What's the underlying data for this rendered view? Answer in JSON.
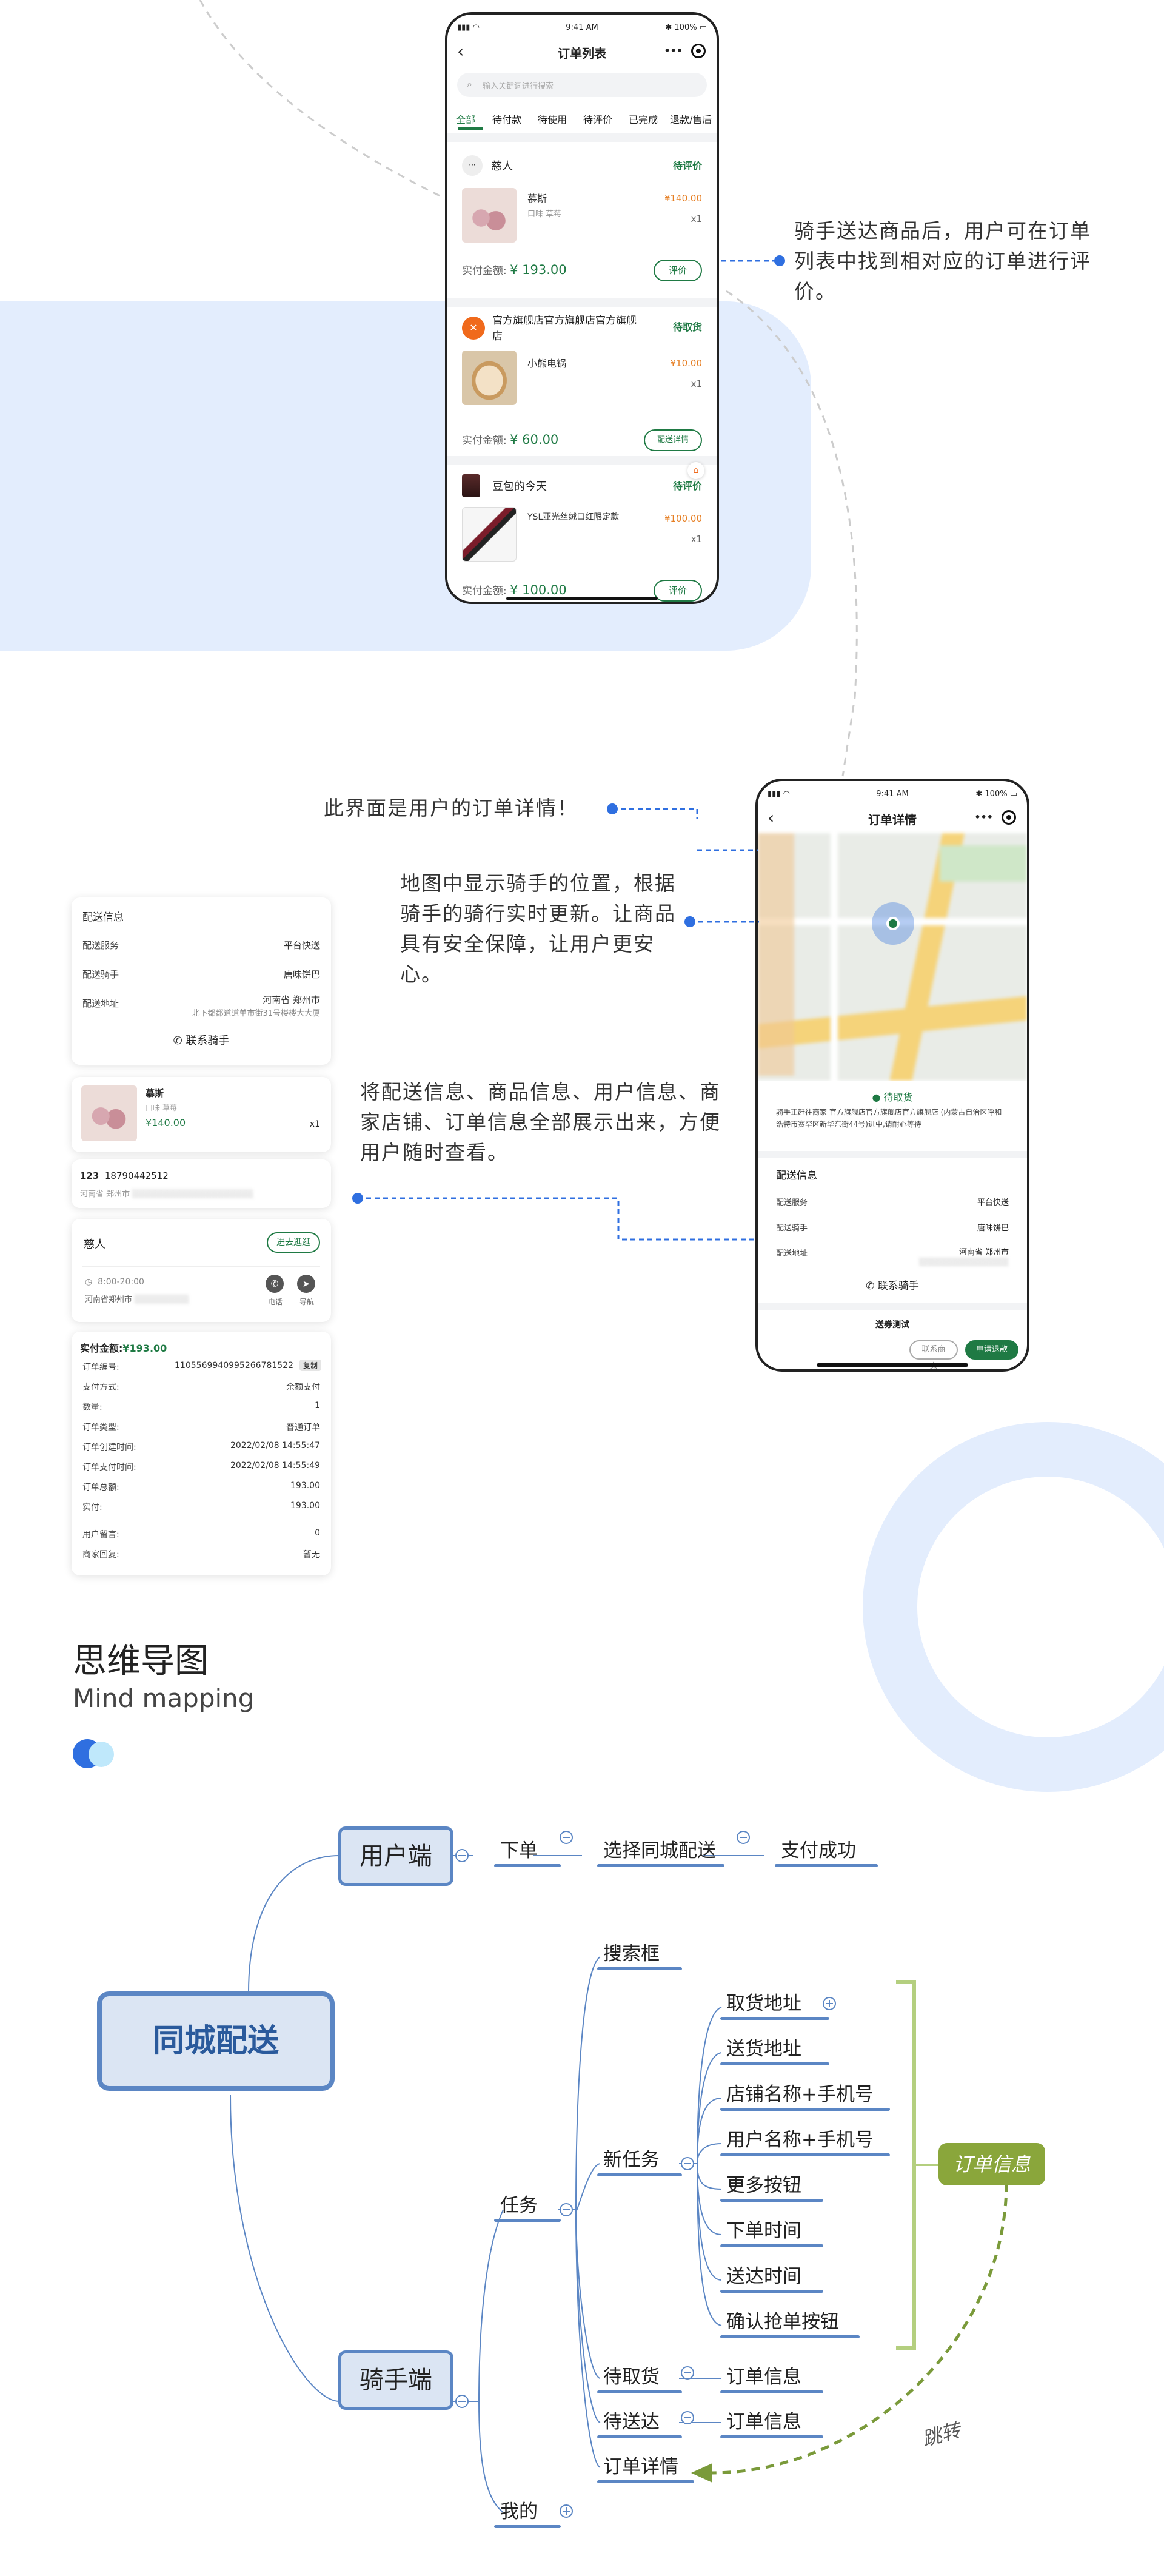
{
  "colors": {
    "green": "#1f7a44",
    "blue": "#2f6fe0",
    "lightblue": "#e3edfd",
    "orange": "#e67e22",
    "olive": "#8aa63b",
    "node_blue": "#5b86c4"
  },
  "phone1": {
    "status_time": "9:41 AM",
    "battery": "100%",
    "title": "订单列表",
    "more": "•••",
    "search_placeholder": "输入关键词进行搜索",
    "tabs": [
      "全部",
      "待付款",
      "待使用",
      "待评价",
      "已完成",
      "退款/售后"
    ],
    "orders": [
      {
        "store": "慈人",
        "status": "待评价",
        "product": "慕斯",
        "spec": "口味 草莓",
        "price": "¥140.00",
        "qty": "x1",
        "pay_label": "实付金额:",
        "pay_amount": "¥ 193.00",
        "button": "评价"
      },
      {
        "store": "官方旗舰店官方旗舰店官方旗舰店",
        "status": "待取货",
        "product": "小熊电锅",
        "price": "¥10.00",
        "qty": "x1",
        "pay_label": "实付金额:",
        "pay_amount": "¥ 60.00",
        "button": "配送详情"
      },
      {
        "store": "豆包的今天",
        "status": "待评价",
        "product": "YSL亚光丝绒口红限定款",
        "price": "¥100.00",
        "qty": "x1",
        "pay_label": "实付金额:",
        "pay_amount": "¥ 100.00",
        "button": "评价"
      }
    ]
  },
  "anno1": "骑手送达商品后，用户可在订单列表中找到相对应的订单进行评价。",
  "anno2": "此界面是用户的订单详情！",
  "anno3": "地图中显示骑手的位置，根据骑手的骑行实时更新。让商品具有安全保障，让用户更安心。",
  "anno4": "将配送信息、商品信息、用户信息、商家店铺、订单信息全部展示出来，方便用户随时查看。",
  "phone2": {
    "status_time": "9:41 AM",
    "battery": "100%",
    "title": "订单详情",
    "more": "•••",
    "status": "待取货",
    "desc": "骑手正赶往商家 官方旗舰店官方旗舰店官方旗舰店 (内蒙古自治区呼和浩特市赛罕区新华东街44号)进中,请耐心等待",
    "delivery_title": "配送信息",
    "rows": [
      {
        "k": "配送服务",
        "v": "平台快送"
      },
      {
        "k": "配送骑手",
        "v": "唐味饼巴"
      },
      {
        "k": "配送地址",
        "v": "河南省 郑州市"
      }
    ],
    "contact": "联系骑手",
    "section2": "送券测试",
    "btn1": "联系商家",
    "btn2": "申请退款"
  },
  "detail_cards": {
    "delivery": {
      "title": "配送信息",
      "rows": [
        {
          "k": "配送服务",
          "v": "平台快送"
        },
        {
          "k": "配送骑手",
          "v": "唐味饼巴"
        },
        {
          "k": "配送地址",
          "v": "河南省 郑州市"
        }
      ],
      "addr2": "北下都都道道单市街31号楼楼大大厦",
      "contact": "联系骑手"
    },
    "product": {
      "name": "慕斯",
      "spec": "口味 草莓",
      "price": "¥140.00",
      "qty": "x1"
    },
    "user": {
      "name": "123",
      "phone": "18790442512",
      "addr": "河南省 郑州市"
    },
    "shop": {
      "name": "慈人",
      "enter": "进去逛逛",
      "hours": "8:00-20:00",
      "addr": "河南省郑州市",
      "call": "电话",
      "nav": "导航"
    },
    "order": {
      "total_label": "实付金额:",
      "total": "¥193.00",
      "rows": [
        {
          "k": "订单编号:",
          "v": "1105569940995266781522",
          "copy": "复制"
        },
        {
          "k": "支付方式:",
          "v": "余额支付"
        },
        {
          "k": "数量:",
          "v": "1"
        },
        {
          "k": "订单类型:",
          "v": "普通订单"
        },
        {
          "k": "订单创建时间:",
          "v": "2022/02/08 14:55:47"
        },
        {
          "k": "订单支付时间:",
          "v": "2022/02/08 14:55:49"
        },
        {
          "k": "订单总额:",
          "v": "193.00"
        },
        {
          "k": "实付:",
          "v": "193.00"
        },
        {
          "k": "用户留言:",
          "v": "0"
        },
        {
          "k": "商家回复:",
          "v": "暂无"
        }
      ]
    }
  },
  "section": {
    "title": "思维导图",
    "subtitle": "Mind mapping"
  },
  "mindmap": {
    "root": "同城配送",
    "user_end": "用户端",
    "rider_end": "骑手端",
    "order": "下单",
    "select": "选择同城配送",
    "paid": "支付成功",
    "search": "搜索框",
    "task": "任务",
    "new_task": "新任务",
    "items": [
      "取货地址",
      "送货地址",
      "店铺名称+手机号",
      "用户名称+手机号",
      "更多按钮",
      "下单时间",
      "送达时间",
      "确认抢单按钮"
    ],
    "pickup": "待取货",
    "deliver": "待送达",
    "order_info": "订单信息",
    "order_detail": "订单详情",
    "mine": "我的",
    "tag": "订单信息",
    "jump": "跳转"
  }
}
